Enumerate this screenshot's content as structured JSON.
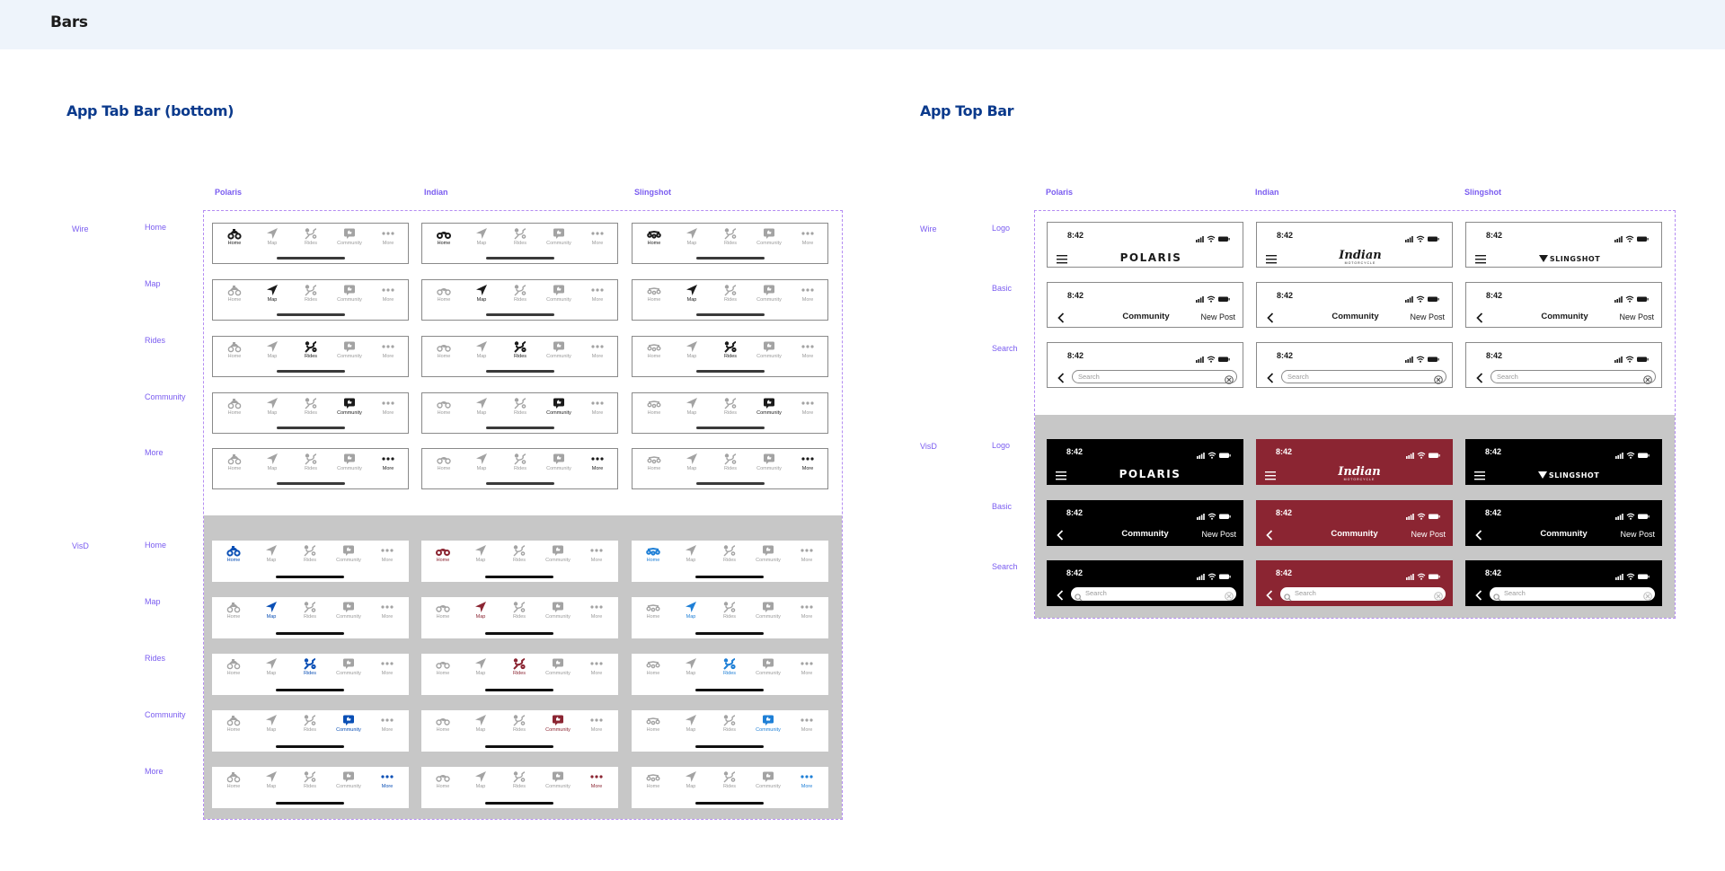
{
  "page": {
    "title": "Bars"
  },
  "colors": {
    "polaris_blue": "#0a4fb5",
    "indian_red": "#8b2532",
    "slingshot_blue": "#1e7fd6",
    "label_purple": "#7a5cf0",
    "header_bg": "#eef4fb"
  },
  "tab_section": {
    "title": "App Tab Bar (bottom)",
    "columns": [
      "Polaris",
      "Indian",
      "Slingshot"
    ],
    "groups": [
      "Wire",
      "VisD"
    ],
    "rows": [
      "Home",
      "Map",
      "Rides",
      "Community",
      "More"
    ],
    "tabs": [
      {
        "label": "Home",
        "icon": "vehicle-icon"
      },
      {
        "label": "Map",
        "icon": "map-arrow-icon"
      },
      {
        "label": "Rides",
        "icon": "rides-route-icon"
      },
      {
        "label": "Community",
        "icon": "community-chat-icon"
      },
      {
        "label": "More",
        "icon": "more-dots-icon"
      }
    ]
  },
  "top_section": {
    "title": "App Top Bar",
    "columns": [
      "Polaris",
      "Indian",
      "Slingshot"
    ],
    "groups": [
      "Wire",
      "VisD"
    ],
    "rows": [
      "Logo",
      "Basic",
      "Search"
    ],
    "time": "8:42",
    "basic_title": "Community",
    "basic_action": "New Post",
    "search_placeholder": "Search",
    "logos": [
      "POLARIS",
      "Indian",
      "SLINGSHOT"
    ],
    "logo_subtexts": [
      "",
      "MOTORCYCLE",
      ""
    ]
  }
}
